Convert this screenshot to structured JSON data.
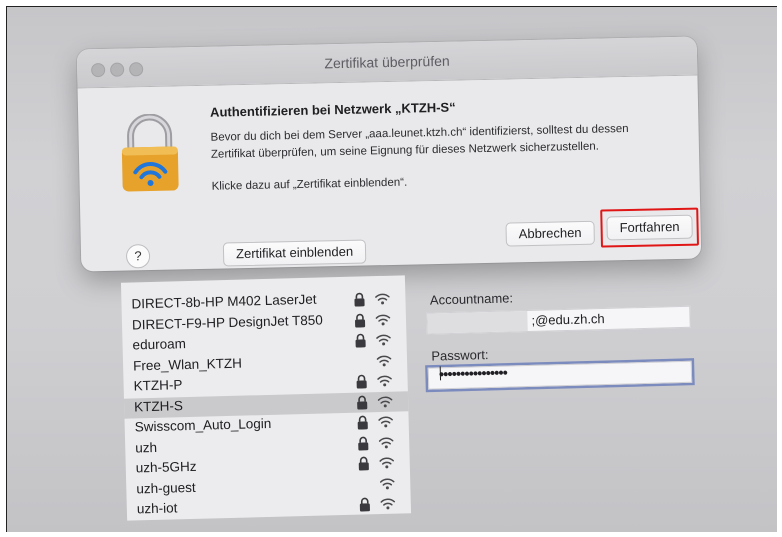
{
  "dialog": {
    "title": "Zertifikat überprüfen",
    "heading": "Authentifizieren bei Netzwerk „KTZH-S“",
    "body": "Bevor du dich bei dem Server „aaa.leunet.ktzh.ch“ identifizierst, solltest du dessen Zertifikat überprüfen, um seine Eignung für dieses Netzwerk sicherzustellen.",
    "hint": "Klicke dazu auf „Zertifikat einblenden“.",
    "help_label": "?",
    "show_cert_label": "Zertifikat einblenden",
    "cancel_label": "Abbrechen",
    "continue_label": "Fortfahren",
    "icon": "lock-wifi-icon"
  },
  "networks": [
    {
      "name": "DIRECT-8b-HP M402 LaserJet",
      "locked": true
    },
    {
      "name": "DIRECT-F9-HP DesignJet T850",
      "locked": true
    },
    {
      "name": "eduroam",
      "locked": true
    },
    {
      "name": "Free_Wlan_KTZH",
      "locked": false
    },
    {
      "name": "KTZH-P",
      "locked": true
    },
    {
      "name": "KTZH-S",
      "locked": true,
      "selected": true
    },
    {
      "name": "Swisscom_Auto_Login",
      "locked": true
    },
    {
      "name": "uzh",
      "locked": true
    },
    {
      "name": "uzh-5GHz",
      "locked": true
    },
    {
      "name": "uzh-guest",
      "locked": false
    },
    {
      "name": "uzh-iot",
      "locked": true
    }
  ],
  "form": {
    "account_label": "Accountname:",
    "account_value": ";@edu.zh.ch",
    "password_label": "Passwort:",
    "password_value": "••••••••••••••••"
  },
  "colors": {
    "highlight": "#e01616",
    "lock_gold": "#e7a22c",
    "wifi_blue": "#2176d9",
    "selected_row": "#cacacd"
  }
}
